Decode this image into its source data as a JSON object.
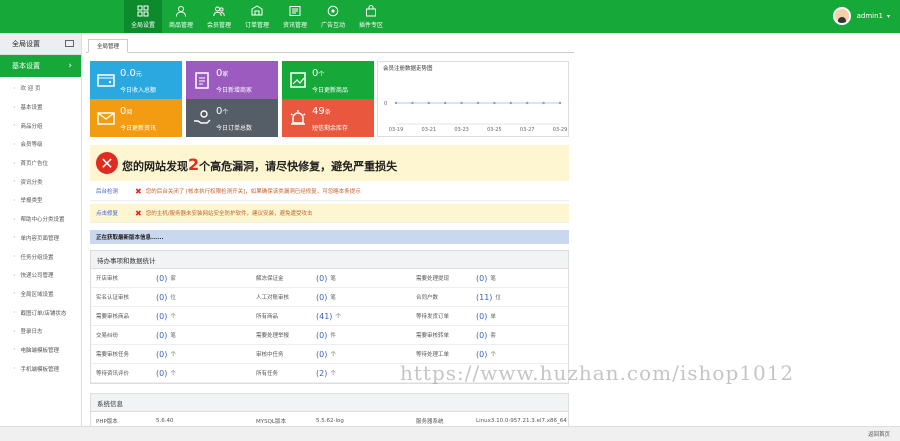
{
  "nav": {
    "items": [
      {
        "label": "全局设置",
        "icon": "grid-icon",
        "active": true
      },
      {
        "label": "商品管理",
        "icon": "user-icon",
        "active": false
      },
      {
        "label": "会员管理",
        "icon": "users-icon",
        "active": false
      },
      {
        "label": "订单管理",
        "icon": "box-icon",
        "active": false
      },
      {
        "label": "资讯管理",
        "icon": "news-icon",
        "active": false
      },
      {
        "label": "广告互动",
        "icon": "circle-icon",
        "active": false
      },
      {
        "label": "插件专区",
        "icon": "bag-icon",
        "active": false
      }
    ],
    "user": "admin1"
  },
  "sidebar": {
    "header": "全局设置",
    "selected": "基本设置",
    "items": [
      "欢 迎 页",
      "基本设置",
      "商品分组",
      "会员等级",
      "首页广告位",
      "资讯分类",
      "举报类型",
      "帮助中心分类设置",
      "单内容页面管理",
      "任务分组设置",
      "快递公司管理",
      "全局区域设置",
      "截图订单/店铺状态",
      "登录日志",
      "电脑端模板管理",
      "手机端模板管理"
    ]
  },
  "tab": "全局管理",
  "cards": [
    {
      "value": "0.0",
      "unit": "元",
      "label": "今日收入总额",
      "color": "#29a9e0",
      "icon": "wallet-icon"
    },
    {
      "value": "0",
      "unit": "家",
      "label": "今日新增商家",
      "color": "#9b5bbf",
      "icon": "clipboard-icon"
    },
    {
      "value": "0",
      "unit": "个",
      "label": "今日更新商品",
      "color": "#17a83a",
      "icon": "chart-doc-icon"
    },
    {
      "value": "0",
      "unit": "阅",
      "label": "今日更新资讯",
      "color": "#f39c12",
      "icon": "mail-icon"
    },
    {
      "value": "0",
      "unit": "个",
      "label": "今日订单总数",
      "color": "#555d66",
      "icon": "hand-icon"
    },
    {
      "value": "49",
      "unit": "条",
      "label": "短信剩余库存",
      "color": "#e9573f",
      "icon": "alarm-icon"
    }
  ],
  "chart_data": {
    "type": "line",
    "title": "会员注册数据走势图",
    "x": [
      "03-19",
      "03-20",
      "03-21",
      "03-22",
      "03-23",
      "03-24",
      "03-25",
      "03-26",
      "03-27",
      "03-28",
      "03-29"
    ],
    "tick_labels": [
      "03-19",
      "03-21",
      "03-23",
      "03-25",
      "03-27",
      "03-29"
    ],
    "series": [
      {
        "values": [
          0,
          0,
          0,
          0,
          0,
          0,
          0,
          0,
          0,
          0,
          0
        ]
      }
    ],
    "y_tick": "0",
    "color": "#9bb8e0"
  },
  "alert": {
    "prefix": "您的网站发现",
    "count": "2",
    "suffix": "个高危漏洞，请尽快修复，避免严重损失"
  },
  "issues": [
    {
      "key": "后台检测",
      "text": "您的后台关闭了 [帐本执行权限检测开关]，如果确保该类漏洞已经修复，可忽略本条提示"
    },
    {
      "key": "点击修复",
      "text": "您的主机/服务器未安装网站安全防护软件，建议安装，避免遭受攻击"
    }
  ],
  "loading": "正在获取最新版本信息......",
  "todo": {
    "title": "待办事项和数据统计",
    "rows": [
      [
        "开店审核",
        "(0)",
        "家",
        "解冻保证金",
        "(0)",
        "笔",
        "需要处理提现",
        "(0)",
        "笔"
      ],
      [
        "实名认证审核",
        "(0)",
        "位",
        "人工对账审核",
        "(0)",
        "笔",
        "合同户数",
        "(11)",
        "位"
      ],
      [
        "需要审核商品",
        "(0)",
        "个",
        "所有商品",
        "(41)",
        "个",
        "等待发货订单",
        "(0)",
        "单"
      ],
      [
        "交易纠纷",
        "(0)",
        "笔",
        "需要处理举报",
        "(0)",
        "件",
        "需要审核转单",
        "(0)",
        "套"
      ],
      [
        "需要审核任务",
        "(0)",
        "个",
        "审核中任务",
        "(0)",
        "个",
        "等待处理工单",
        "(0)",
        "个"
      ],
      [
        "等待资讯评价",
        "(0)",
        "个",
        "所有任务",
        "(2)",
        "个",
        "",
        "",
        ""
      ]
    ]
  },
  "system": {
    "title": "系统信息",
    "row": [
      "PHP版本",
      "5.6.40",
      "MYSQL版本",
      "5.5.62-log",
      "服务器系统",
      "Linux3.10.0-957.21.3.el7.x86_64"
    ]
  },
  "watermark": "https://www.huzhan.com/ishop1012",
  "statusbar": "返回首页"
}
